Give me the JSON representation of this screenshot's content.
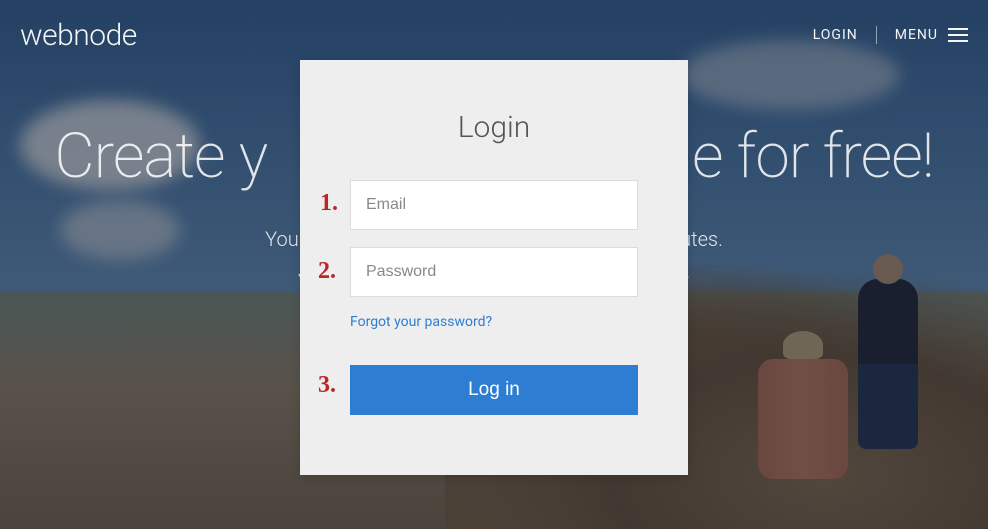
{
  "brand": "webnode",
  "header": {
    "login": "LOGIN",
    "menu": "MENU"
  },
  "hero": {
    "title_left": "Create y",
    "title_right": "e for free!",
    "sub_line1_left": "You can crea",
    "sub_line1_right": "ust minutes.",
    "sub_line2_left": "Joi",
    "sub_line2_right": "elf."
  },
  "modal": {
    "title": "Login",
    "email_placeholder": "Email",
    "password_placeholder": "Password",
    "forgot": "Forgot your password?",
    "submit": "Log in"
  },
  "annotations": {
    "a1": "1.",
    "a2": "2.",
    "a3": "3."
  }
}
